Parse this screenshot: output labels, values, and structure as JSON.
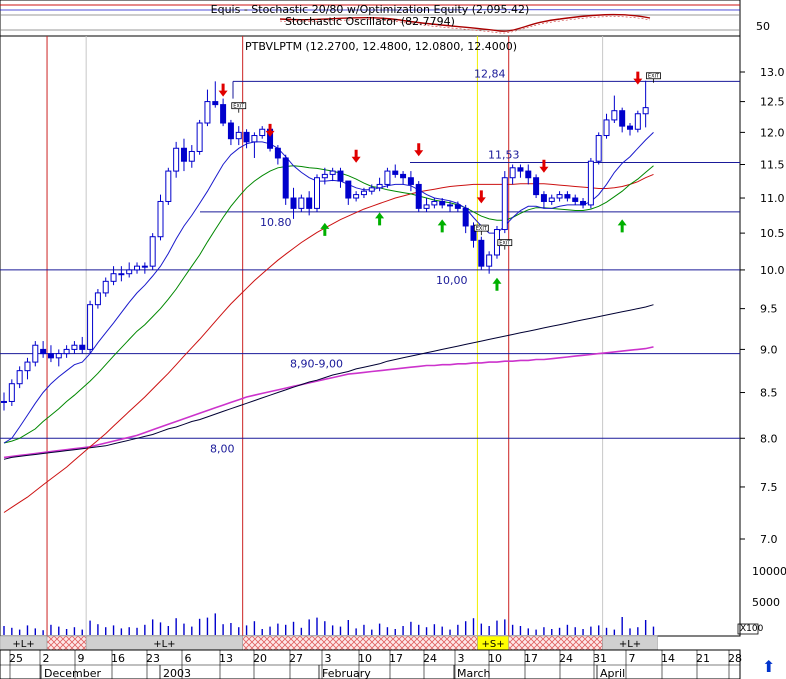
{
  "colors": {
    "candle": "#0000cc",
    "ma_fast": "#1a1acc",
    "ma_mid": "#008800",
    "ma_slow": "#cc1111",
    "ma_long_black": "#000033",
    "ma_long_magenta": "#cc33cc",
    "sell_arrow": "#e00000",
    "buy_arrow": "#00b000",
    "vline_red": "#cc2222",
    "vline_yellow": "#f0f000",
    "vline_gray": "#c8c8c8",
    "level_line": "#1a1a99",
    "volume": "#0000cc",
    "band_hatch": "#e88080",
    "band_yellow": "#ffff00"
  },
  "header": {
    "title": "Equis - Stochastic 20/80 w/Optimization Equity (2,095.42)",
    "indicator": "Stochastic Oscillator (82.7794)",
    "indicator_axis_label": "50"
  },
  "chart_data": {
    "type": "candlestick",
    "title": "PTBVLPTM (12.2700, 12.4800, 12.0800, 12.4000)",
    "y_axis": {
      "ticks": [
        "13.0",
        "12.5",
        "12.0",
        "11.5",
        "11.0",
        "10.5",
        "10.0",
        "9.5",
        "9.0",
        "8.5",
        "8.0",
        "7.5",
        "7.0"
      ],
      "scale": "log",
      "range": [
        6.8,
        13.3
      ]
    },
    "volume_axis": {
      "ticks": [
        "10000",
        "5000",
        "X100"
      ]
    },
    "x_axis": {
      "day_ticks": [
        "25",
        "2",
        "9",
        "16",
        "23",
        "6",
        "13",
        "20",
        "27",
        "3",
        "10",
        "17",
        "24",
        "3",
        "10",
        "17",
        "24",
        "31",
        "7",
        "14",
        "21",
        "28"
      ],
      "months": [
        "December",
        "2003",
        "February",
        "March",
        "April"
      ]
    },
    "levels": [
      {
        "value": 12.84,
        "label": "12,84"
      },
      {
        "value": 11.53,
        "label": "11,53"
      },
      {
        "value": 10.8,
        "label": "10.80"
      },
      {
        "value": 10.0,
        "label": "10,00"
      },
      {
        "value": 8.95,
        "label": "8,90-9,00"
      },
      {
        "value": 8.0,
        "label": "8,00"
      }
    ],
    "signal_labels": {
      "exit": "EXIT"
    },
    "band_labels": {
      "long": "+L+",
      "short": "+S+"
    },
    "ohlc": [
      [
        8.4,
        8.5,
        8.3,
        8.4
      ],
      [
        8.4,
        8.65,
        8.35,
        8.6
      ],
      [
        8.6,
        8.8,
        8.55,
        8.75
      ],
      [
        8.75,
        8.9,
        8.65,
        8.85
      ],
      [
        8.85,
        9.1,
        8.8,
        9.05
      ],
      [
        9.0,
        9.1,
        8.9,
        8.95
      ],
      [
        8.95,
        9.05,
        8.85,
        8.9
      ],
      [
        8.9,
        9.0,
        8.8,
        8.95
      ],
      [
        8.95,
        9.05,
        8.9,
        9.0
      ],
      [
        9.0,
        9.1,
        8.95,
        9.05
      ],
      [
        9.05,
        9.15,
        8.95,
        9.0
      ],
      [
        9.0,
        9.6,
        8.95,
        9.55
      ],
      [
        9.55,
        9.75,
        9.5,
        9.7
      ],
      [
        9.7,
        9.9,
        9.65,
        9.85
      ],
      [
        9.85,
        10.05,
        9.8,
        9.95
      ],
      [
        9.95,
        10.05,
        9.85,
        9.95
      ],
      [
        9.95,
        10.1,
        9.9,
        10.0
      ],
      [
        10.0,
        10.1,
        9.95,
        10.05
      ],
      [
        10.05,
        10.1,
        9.95,
        10.05
      ],
      [
        10.05,
        10.5,
        10.0,
        10.45
      ],
      [
        10.45,
        11.05,
        10.4,
        10.95
      ],
      [
        10.95,
        11.45,
        10.9,
        11.4
      ],
      [
        11.4,
        11.85,
        11.3,
        11.75
      ],
      [
        11.75,
        11.9,
        11.4,
        11.55
      ],
      [
        11.55,
        11.8,
        11.45,
        11.7
      ],
      [
        11.7,
        12.2,
        11.65,
        12.15
      ],
      [
        12.15,
        12.7,
        12.1,
        12.5
      ],
      [
        12.5,
        12.84,
        12.4,
        12.45
      ],
      [
        12.45,
        12.55,
        12.1,
        12.15
      ],
      [
        12.15,
        12.2,
        11.8,
        11.9
      ],
      [
        11.9,
        12.1,
        11.8,
        12.0
      ],
      [
        12.0,
        12.05,
        11.75,
        11.85
      ],
      [
        11.85,
        12.0,
        11.6,
        11.95
      ],
      [
        11.95,
        12.1,
        11.9,
        12.05
      ],
      [
        12.05,
        12.05,
        11.7,
        11.75
      ],
      [
        11.75,
        11.8,
        11.5,
        11.6
      ],
      [
        11.6,
        11.65,
        10.9,
        11.0
      ],
      [
        11.0,
        11.15,
        10.7,
        10.85
      ],
      [
        10.85,
        11.05,
        10.8,
        11.0
      ],
      [
        11.0,
        11.1,
        10.75,
        10.85
      ],
      [
        10.85,
        11.35,
        10.8,
        11.3
      ],
      [
        11.3,
        11.45,
        11.2,
        11.35
      ],
      [
        11.35,
        11.45,
        11.25,
        11.4
      ],
      [
        11.4,
        11.45,
        11.15,
        11.25
      ],
      [
        11.25,
        11.25,
        10.9,
        11.0
      ],
      [
        11.0,
        11.1,
        10.95,
        11.05
      ],
      [
        11.05,
        11.15,
        11.0,
        11.1
      ],
      [
        11.1,
        11.2,
        11.05,
        11.15
      ],
      [
        11.15,
        11.3,
        11.1,
        11.2
      ],
      [
        11.2,
        11.45,
        11.15,
        11.4
      ],
      [
        11.4,
        11.5,
        11.3,
        11.35
      ],
      [
        11.35,
        11.4,
        11.2,
        11.3
      ],
      [
        11.3,
        11.4,
        11.1,
        11.2
      ],
      [
        11.2,
        11.25,
        10.8,
        10.85
      ],
      [
        10.85,
        11.0,
        10.8,
        10.9
      ],
      [
        10.9,
        11.0,
        10.85,
        10.95
      ],
      [
        10.95,
        11.0,
        10.85,
        10.9
      ],
      [
        10.9,
        10.95,
        10.8,
        10.9
      ],
      [
        10.9,
        10.95,
        10.8,
        10.85
      ],
      [
        10.85,
        10.9,
        10.5,
        10.6
      ],
      [
        10.6,
        10.65,
        10.3,
        10.4
      ],
      [
        10.4,
        10.45,
        10.0,
        10.05
      ],
      [
        10.05,
        10.25,
        9.95,
        10.2
      ],
      [
        10.2,
        10.6,
        10.15,
        10.55
      ],
      [
        10.55,
        11.4,
        10.5,
        11.3
      ],
      [
        11.3,
        11.5,
        11.2,
        11.45
      ],
      [
        11.45,
        11.5,
        11.3,
        11.4
      ],
      [
        11.4,
        11.5,
        11.2,
        11.3
      ],
      [
        11.3,
        11.35,
        11.0,
        11.05
      ],
      [
        11.05,
        11.1,
        10.85,
        10.95
      ],
      [
        10.95,
        11.05,
        10.9,
        11.0
      ],
      [
        11.0,
        11.1,
        10.95,
        11.05
      ],
      [
        11.05,
        11.1,
        10.95,
        11.0
      ],
      [
        11.0,
        11.05,
        10.9,
        10.95
      ],
      [
        10.95,
        11.0,
        10.85,
        10.9
      ],
      [
        10.9,
        11.6,
        10.85,
        11.55
      ],
      [
        11.55,
        12.0,
        11.5,
        11.95
      ],
      [
        11.95,
        12.3,
        11.9,
        12.2
      ],
      [
        12.2,
        12.6,
        12.15,
        12.35
      ],
      [
        12.35,
        12.4,
        12.0,
        12.1
      ],
      [
        12.1,
        12.15,
        11.95,
        12.05
      ],
      [
        12.05,
        12.35,
        12.0,
        12.3
      ],
      [
        12.3,
        12.85,
        12.08,
        12.4
      ]
    ],
    "volume": [
      1500,
      1200,
      900,
      1600,
      1100,
      800,
      1700,
      1400,
      1000,
      1300,
      900,
      2400,
      1800,
      1300,
      1600,
      1100,
      1300,
      1200,
      1700,
      2600,
      2100,
      1500,
      2800,
      1900,
      1400,
      2700,
      2900,
      3600,
      1800,
      2000,
      1300,
      1600,
      2300,
      1000,
      1400,
      1900,
      1700,
      2200,
      1200,
      2600,
      2900,
      2300,
      1600,
      1400,
      2500,
      1100,
      1700,
      900,
      1900,
      1300,
      1000,
      1500,
      2200,
      1700,
      1300,
      1800,
      1400,
      900,
      1700,
      2300,
      2800,
      1900,
      1500,
      2400,
      2600,
      1700,
      1500,
      1100,
      900,
      1300,
      1000,
      1200,
      1700,
      1300,
      1000,
      1400,
      1600,
      1200,
      900,
      3000,
      1100,
      1300,
      2500,
      1400
    ],
    "ma_fast": [
      7.95,
      8.0,
      8.12,
      8.25,
      8.38,
      8.5,
      8.6,
      8.68,
      8.75,
      8.82,
      8.85,
      8.95,
      9.08,
      9.2,
      9.32,
      9.45,
      9.58,
      9.7,
      9.8,
      9.92,
      10.05,
      10.22,
      10.42,
      10.6,
      10.75,
      10.92,
      11.1,
      11.3,
      11.5,
      11.65,
      11.75,
      11.82,
      11.85,
      11.85,
      11.82,
      11.75,
      11.62,
      11.48,
      11.38,
      11.3,
      11.25,
      11.25,
      11.26,
      11.25,
      11.2,
      11.15,
      11.12,
      11.12,
      11.15,
      11.18,
      11.2,
      11.2,
      11.18,
      11.12,
      11.05,
      11.0,
      10.98,
      10.96,
      10.92,
      10.85,
      10.72,
      10.6,
      10.5,
      10.5,
      10.6,
      10.72,
      10.82,
      10.88,
      10.88,
      10.85,
      10.85,
      10.88,
      10.9,
      10.9,
      10.9,
      10.95,
      11.05,
      11.2,
      11.38,
      11.52,
      11.62,
      11.75,
      11.88,
      12.0
    ],
    "ma_mid": [
      7.95,
      7.97,
      8.0,
      8.05,
      8.1,
      8.18,
      8.25,
      8.32,
      8.4,
      8.47,
      8.55,
      8.63,
      8.72,
      8.82,
      8.92,
      9.02,
      9.12,
      9.22,
      9.3,
      9.4,
      9.5,
      9.62,
      9.75,
      9.9,
      10.05,
      10.2,
      10.38,
      10.55,
      10.72,
      10.88,
      11.02,
      11.15,
      11.25,
      11.33,
      11.4,
      11.45,
      11.47,
      11.48,
      11.47,
      11.45,
      11.44,
      11.42,
      11.4,
      11.37,
      11.33,
      11.28,
      11.22,
      11.17,
      11.15,
      11.12,
      11.1,
      11.08,
      11.06,
      11.03,
      11.0,
      10.97,
      10.95,
      10.93,
      10.9,
      10.86,
      10.8,
      10.74,
      10.7,
      10.68,
      10.68,
      10.72,
      10.78,
      10.83,
      10.86,
      10.86,
      10.85,
      10.84,
      10.83,
      10.82,
      10.82,
      10.84,
      10.88,
      10.94,
      11.02,
      11.1,
      11.2,
      11.28,
      11.38,
      11.48
    ],
    "ma_slow": [
      7.25,
      7.3,
      7.35,
      7.4,
      7.46,
      7.52,
      7.58,
      7.64,
      7.7,
      7.77,
      7.84,
      7.91,
      7.98,
      8.05,
      8.13,
      8.21,
      8.29,
      8.37,
      8.45,
      8.54,
      8.63,
      8.72,
      8.82,
      8.92,
      9.02,
      9.12,
      9.23,
      9.34,
      9.45,
      9.56,
      9.66,
      9.76,
      9.86,
      9.95,
      10.04,
      10.13,
      10.21,
      10.29,
      10.37,
      10.44,
      10.51,
      10.57,
      10.63,
      10.69,
      10.74,
      10.79,
      10.84,
      10.88,
      10.92,
      10.96,
      11.0,
      11.03,
      11.06,
      11.09,
      11.11,
      11.13,
      11.15,
      11.17,
      11.18,
      11.19,
      11.2,
      11.2,
      11.2,
      11.2,
      11.2,
      11.2,
      11.21,
      11.21,
      11.21,
      11.21,
      11.2,
      11.19,
      11.18,
      11.17,
      11.16,
      11.15,
      11.14,
      11.14,
      11.15,
      11.17,
      11.2,
      11.24,
      11.3,
      11.35
    ],
    "ma_long_black": [
      7.78,
      7.8,
      7.81,
      7.82,
      7.83,
      7.84,
      7.85,
      7.86,
      7.87,
      7.88,
      7.89,
      7.9,
      7.91,
      7.92,
      7.94,
      7.96,
      7.98,
      8.0,
      8.02,
      8.04,
      8.07,
      8.1,
      8.12,
      8.15,
      8.18,
      8.2,
      8.23,
      8.26,
      8.29,
      8.32,
      8.35,
      8.38,
      8.41,
      8.44,
      8.47,
      8.5,
      8.53,
      8.56,
      8.59,
      8.62,
      8.64,
      8.67,
      8.7,
      8.72,
      8.74,
      8.77,
      8.79,
      8.81,
      8.83,
      8.86,
      8.88,
      8.9,
      8.92,
      8.94,
      8.96,
      8.98,
      9.0,
      9.02,
      9.04,
      9.06,
      9.08,
      9.1,
      9.12,
      9.14,
      9.16,
      9.18,
      9.2,
      9.22,
      9.24,
      9.26,
      9.28,
      9.3,
      9.32,
      9.34,
      9.36,
      9.38,
      9.4,
      9.42,
      9.44,
      9.46,
      9.48,
      9.5,
      9.52,
      9.55
    ],
    "ma_long_magenta": [
      7.8,
      7.81,
      7.82,
      7.83,
      7.84,
      7.85,
      7.86,
      7.87,
      7.88,
      7.89,
      7.9,
      7.91,
      7.93,
      7.95,
      7.97,
      7.99,
      8.01,
      8.03,
      8.06,
      8.09,
      8.12,
      8.15,
      8.18,
      8.21,
      8.24,
      8.27,
      8.3,
      8.33,
      8.36,
      8.39,
      8.42,
      8.45,
      8.47,
      8.49,
      8.51,
      8.53,
      8.55,
      8.57,
      8.59,
      8.61,
      8.63,
      8.65,
      8.67,
      8.69,
      8.71,
      8.72,
      8.73,
      8.74,
      8.75,
      8.76,
      8.77,
      8.78,
      8.79,
      8.8,
      8.81,
      8.81,
      8.82,
      8.82,
      8.83,
      8.83,
      8.84,
      8.84,
      8.85,
      8.85,
      8.86,
      8.86,
      8.87,
      8.87,
      8.88,
      8.88,
      8.89,
      8.9,
      8.91,
      8.92,
      8.93,
      8.94,
      8.95,
      8.96,
      8.97,
      8.98,
      8.99,
      9.0,
      9.01,
      9.03
    ],
    "sell_arrows": [
      [
        28,
        12.5
      ],
      [
        34,
        11.85
      ],
      [
        45,
        11.45
      ],
      [
        53,
        11.55
      ],
      [
        61,
        10.85
      ],
      [
        69,
        11.3
      ],
      [
        81,
        12.7
      ]
    ],
    "buy_arrows": [
      [
        41,
        10.7
      ],
      [
        48,
        10.85
      ],
      [
        56,
        10.75
      ],
      [
        63,
        9.95
      ],
      [
        79,
        10.75
      ]
    ],
    "exit_markers": [
      [
        30,
        12.35
      ],
      [
        61,
        10.5
      ],
      [
        64,
        10.3
      ],
      [
        83,
        12.85
      ]
    ],
    "vlines": [
      {
        "pos": 5.5,
        "color": "vline_red"
      },
      {
        "pos": 10.5,
        "color": "vline_gray"
      },
      {
        "pos": 30.5,
        "color": "vline_red"
      },
      {
        "pos": 60.5,
        "color": "vline_yellow"
      },
      {
        "pos": 64.5,
        "color": "vline_red"
      },
      {
        "pos": 76.5,
        "color": "vline_gray"
      }
    ],
    "bands": [
      {
        "from": 0,
        "to": 5.5,
        "label": "+L+",
        "style": "plain"
      },
      {
        "from": 5.5,
        "to": 10.5,
        "label": "",
        "style": "hatch"
      },
      {
        "from": 10.5,
        "to": 30.5,
        "label": "+L+",
        "style": "plain"
      },
      {
        "from": 30.5,
        "to": 60.5,
        "label": "",
        "style": "hatch"
      },
      {
        "from": 60.5,
        "to": 64.5,
        "label": "+S+",
        "style": "yellow"
      },
      {
        "from": 64.5,
        "to": 76.5,
        "label": "",
        "style": "hatch"
      },
      {
        "from": 76.5,
        "to": 83.5,
        "label": "+L+",
        "style": "plain"
      }
    ]
  }
}
